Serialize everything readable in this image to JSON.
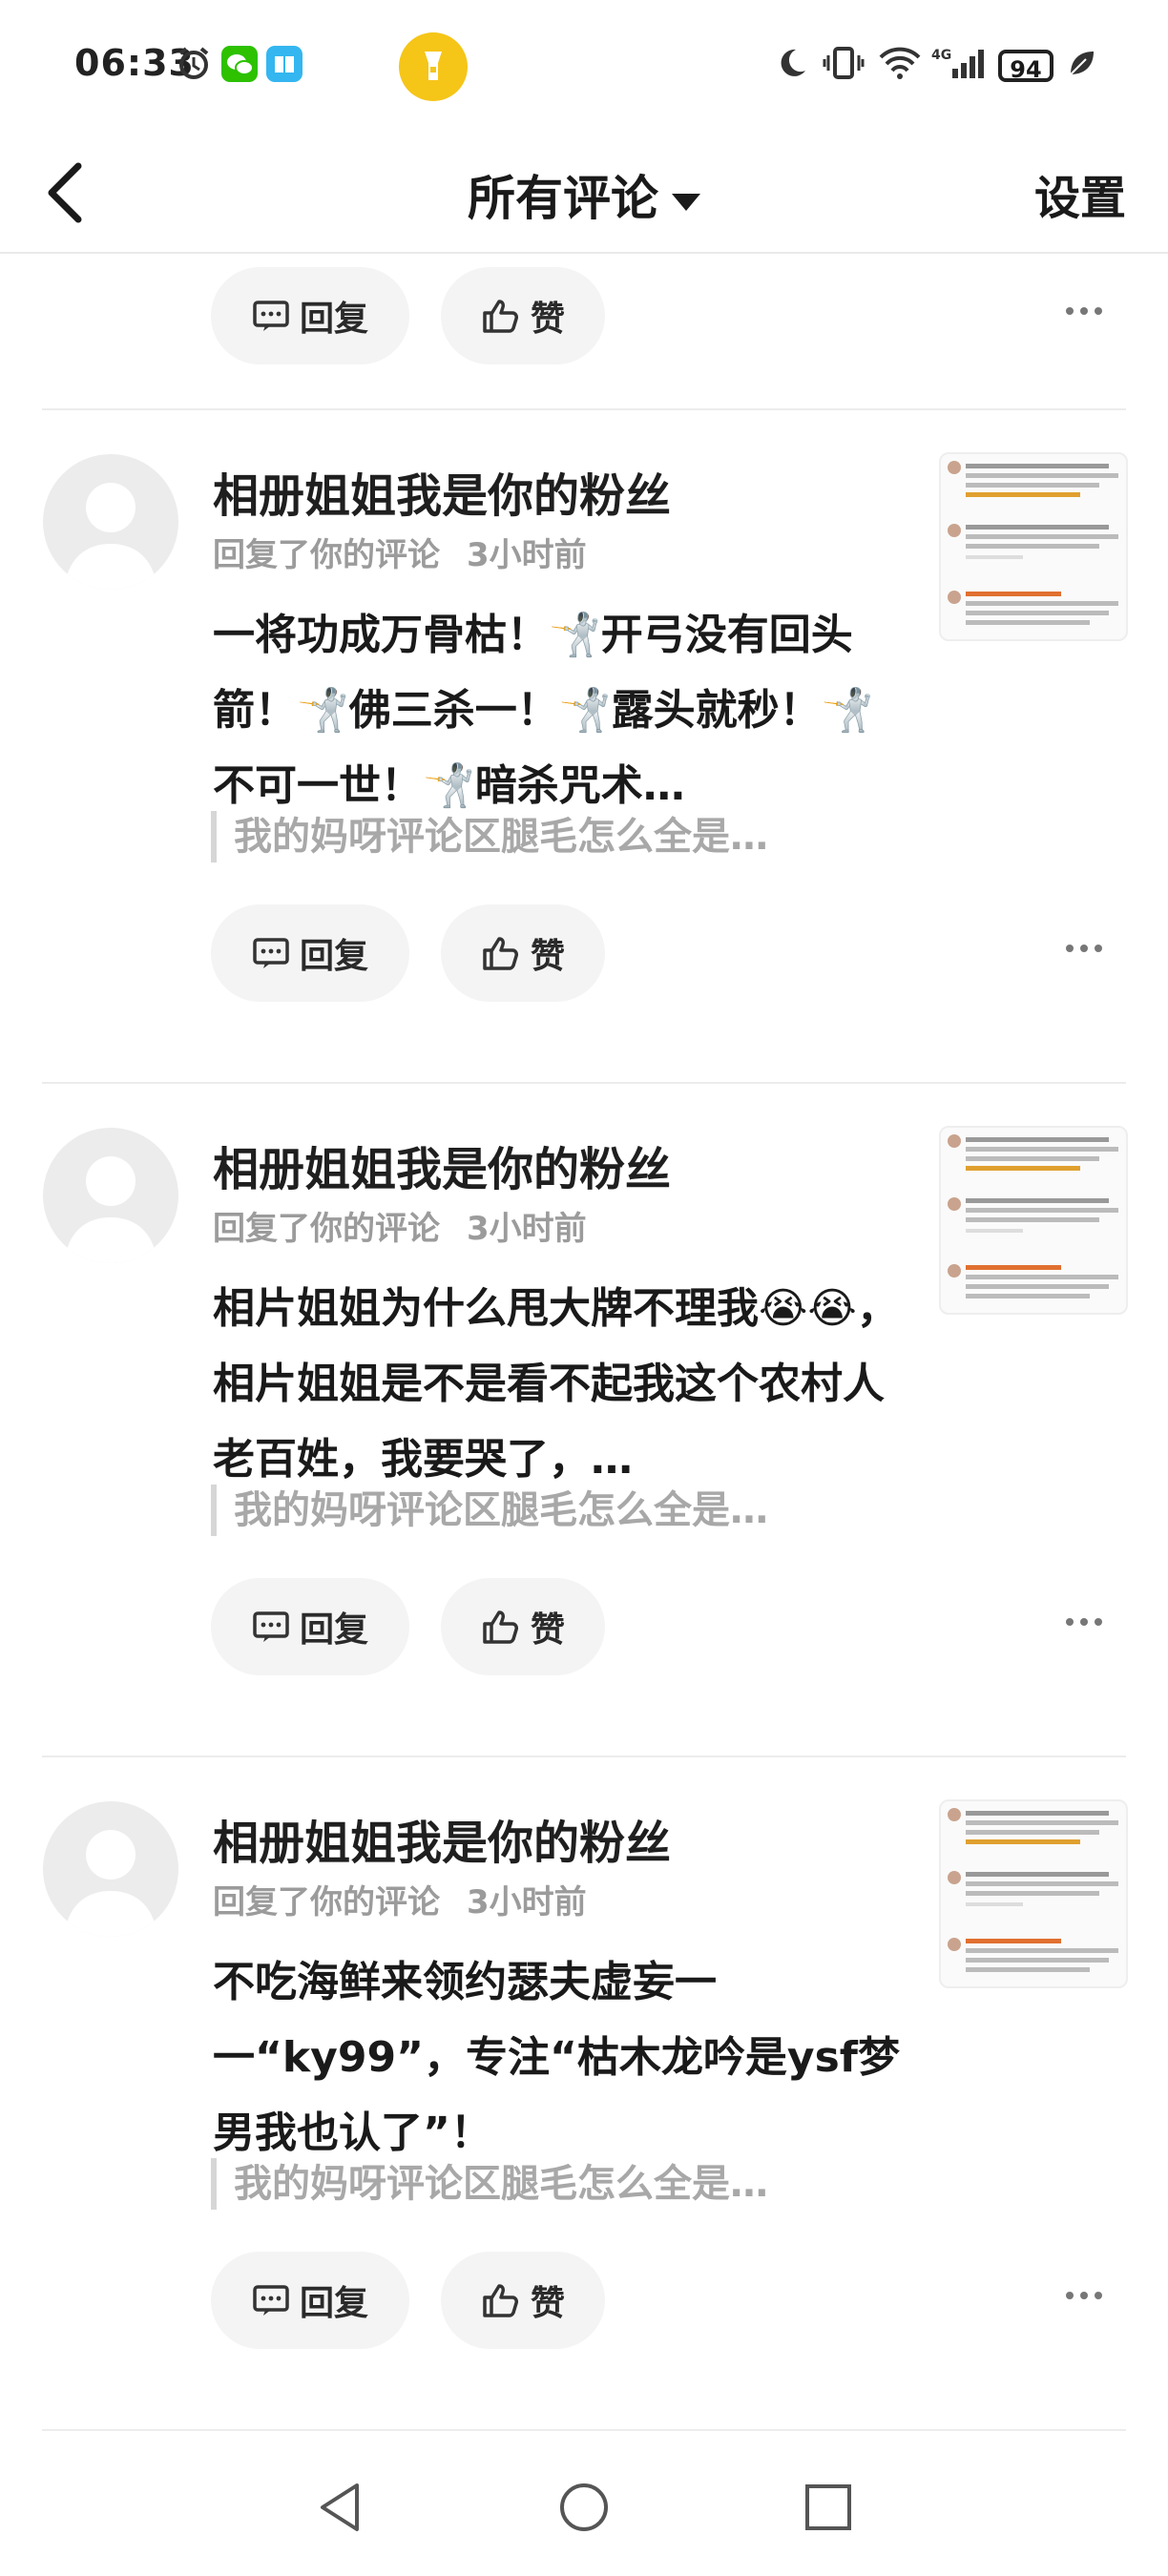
{
  "status_bar": {
    "time": "06:33",
    "battery": "94"
  },
  "header": {
    "title": "所有评论",
    "settings": "设置"
  },
  "top_actions": {
    "reply": "回复",
    "like": "赞"
  },
  "comments": [
    {
      "name": "相册姐姐我是你的粉丝",
      "action": "回复了你的评论",
      "time": "3小时前",
      "content": "一将功成万骨枯！🤺开弓没有回头箭！🤺佛三杀一！🤺露头就秒！🤺不可一世！🤺暗杀咒术…",
      "quote": "我的妈呀评论区腿毛怎么全是…",
      "reply": "回复",
      "like": "赞"
    },
    {
      "name": "相册姐姐我是你的粉丝",
      "action": "回复了你的评论",
      "time": "3小时前",
      "content": "相片姐姐为什么甩大牌不理我😭😭，相片姐姐是不是看不起我这个农村人老百姓，我要哭了，…",
      "quote": "我的妈呀评论区腿毛怎么全是…",
      "reply": "回复",
      "like": "赞"
    },
    {
      "name": "相册姐姐我是你的粉丝",
      "action": "回复了你的评论",
      "time": "3小时前",
      "content": "不吃海鲜来领约瑟夫虚妄一一“ky99”，专注“枯木龙吟是ysf梦男我也认了”！",
      "quote": "我的妈呀评论区腿毛怎么全是…",
      "reply": "回复",
      "like": "赞"
    }
  ],
  "colors": {
    "accent": "#f5c518",
    "muted": "#9b9b9b",
    "pill": "#f4f4f4"
  }
}
